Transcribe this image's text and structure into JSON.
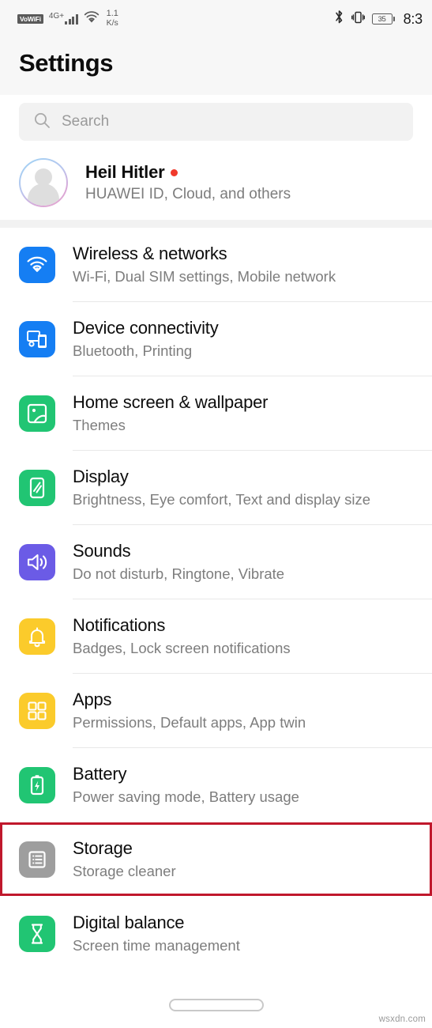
{
  "status_bar": {
    "vowifi_label": "VoWiFi",
    "network_type": "4G+",
    "signal_icon": "signal-bars-icon",
    "wifi_icon": "wifi-icon",
    "data_speed_value": "1.1",
    "data_speed_unit": "K/s",
    "bluetooth_icon": "bluetooth-icon",
    "vibrate_icon": "vibrate-icon",
    "battery_percent": "35",
    "time": "8:3"
  },
  "header": {
    "title": "Settings"
  },
  "search": {
    "icon": "search-icon",
    "placeholder": "Search",
    "value": ""
  },
  "profile": {
    "avatar_icon": "avatar-placeholder-icon",
    "name": "Heil Hitler",
    "badge_icon": "red-dot-badge",
    "subtitle": "HUAWEI ID, Cloud, and others"
  },
  "colors": {
    "blue": "#157EF3",
    "green": "#21C573",
    "purple": "#6B5BE6",
    "yellow": "#FBCB2B",
    "gray": "#9E9E9E",
    "highlight_border": "#C0182C",
    "red_dot": "#F0392B",
    "accent_text": "#7D7D7D"
  },
  "settings_list": [
    {
      "title": "Wireless & networks",
      "subtitle": "Wi-Fi, Dual SIM settings, Mobile network",
      "icon": "wifi-icon",
      "icon_color": "#157EF3",
      "name": "wireless-and-networks",
      "highlighted": false
    },
    {
      "title": "Device connectivity",
      "subtitle": "Bluetooth, Printing",
      "icon": "device-connectivity-icon",
      "icon_color": "#157EF3",
      "name": "device-connectivity",
      "highlighted": false
    },
    {
      "title": "Home screen & wallpaper",
      "subtitle": "Themes",
      "icon": "wallpaper-image-icon",
      "icon_color": "#21C573",
      "name": "home-screen-and-wallpaper",
      "highlighted": false
    },
    {
      "title": "Display",
      "subtitle": "Brightness, Eye comfort, Text and display size",
      "icon": "display-phone-icon",
      "icon_color": "#21C573",
      "name": "display",
      "highlighted": false
    },
    {
      "title": "Sounds",
      "subtitle": "Do not disturb, Ringtone, Vibrate",
      "icon": "speaker-volume-icon",
      "icon_color": "#6B5BE6",
      "name": "sounds",
      "highlighted": false
    },
    {
      "title": "Notifications",
      "subtitle": "Badges, Lock screen notifications",
      "icon": "bell-icon",
      "icon_color": "#FBCB2B",
      "name": "notifications",
      "highlighted": false
    },
    {
      "title": "Apps",
      "subtitle": "Permissions, Default apps, App twin",
      "icon": "apps-grid-icon",
      "icon_color": "#FBCB2B",
      "name": "apps",
      "highlighted": false
    },
    {
      "title": "Battery",
      "subtitle": "Power saving mode, Battery usage",
      "icon": "battery-bolt-icon",
      "icon_color": "#21C573",
      "name": "battery",
      "highlighted": false
    },
    {
      "title": "Storage",
      "subtitle": "Storage cleaner",
      "icon": "storage-list-icon",
      "icon_color": "#9E9E9E",
      "name": "storage",
      "highlighted": true
    },
    {
      "title": "Digital balance",
      "subtitle": "Screen time management",
      "icon": "hourglass-icon",
      "icon_color": "#21C573",
      "name": "digital-balance",
      "highlighted": false
    }
  ],
  "navbar": {
    "home_indicator_icon": "home-indicator-pill"
  },
  "watermark": {
    "text": "wsxdn.com"
  }
}
